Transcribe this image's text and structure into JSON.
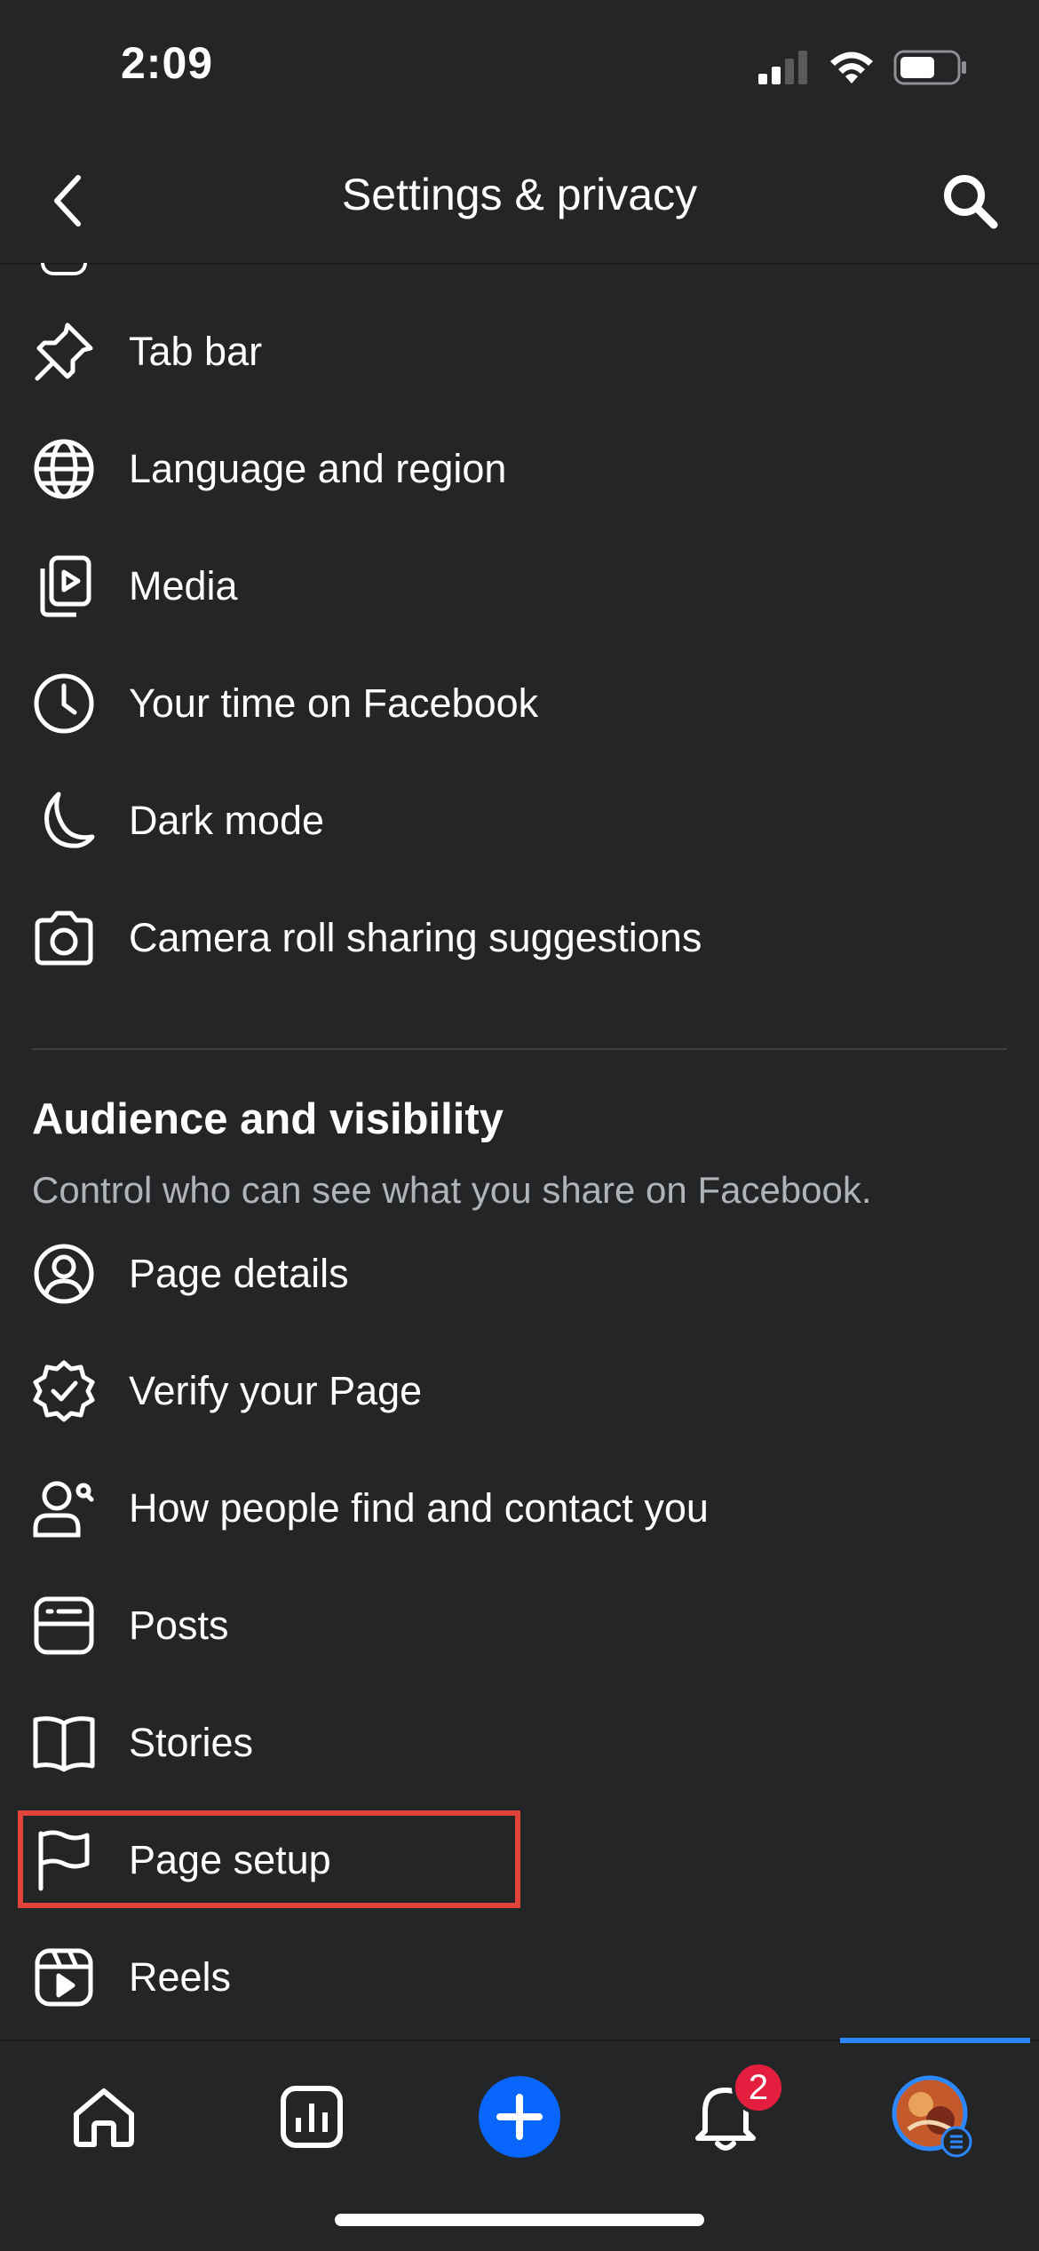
{
  "status_bar": {
    "time": "2:09"
  },
  "header": {
    "title": "Settings & privacy"
  },
  "preferences": {
    "items": [
      {
        "label": "Tab bar",
        "icon": "pin-icon"
      },
      {
        "label": "Language and region",
        "icon": "globe-icon"
      },
      {
        "label": "Media",
        "icon": "media-icon"
      },
      {
        "label": "Your time on Facebook",
        "icon": "clock-icon"
      },
      {
        "label": "Dark mode",
        "icon": "moon-icon"
      },
      {
        "label": "Camera roll sharing suggestions",
        "icon": "camera-icon"
      }
    ]
  },
  "audience": {
    "title": "Audience and visibility",
    "subtitle": "Control who can see what you share on Facebook.",
    "items": [
      {
        "label": "Page details",
        "icon": "person-circle-icon"
      },
      {
        "label": "Verify your Page",
        "icon": "verified-badge-icon"
      },
      {
        "label": "How people find and contact you",
        "icon": "person-search-icon"
      },
      {
        "label": "Posts",
        "icon": "posts-icon"
      },
      {
        "label": "Stories",
        "icon": "book-icon"
      },
      {
        "label": "Page setup",
        "icon": "flag-icon"
      },
      {
        "label": "Reels",
        "icon": "reels-icon"
      }
    ]
  },
  "tabbar": {
    "notifications_badge": "2",
    "active_tab": "profile",
    "accent_color": "#2d88ff"
  },
  "colors": {
    "background": "#242527",
    "highlight": "#e0433a",
    "badge": "#e41e3f"
  }
}
